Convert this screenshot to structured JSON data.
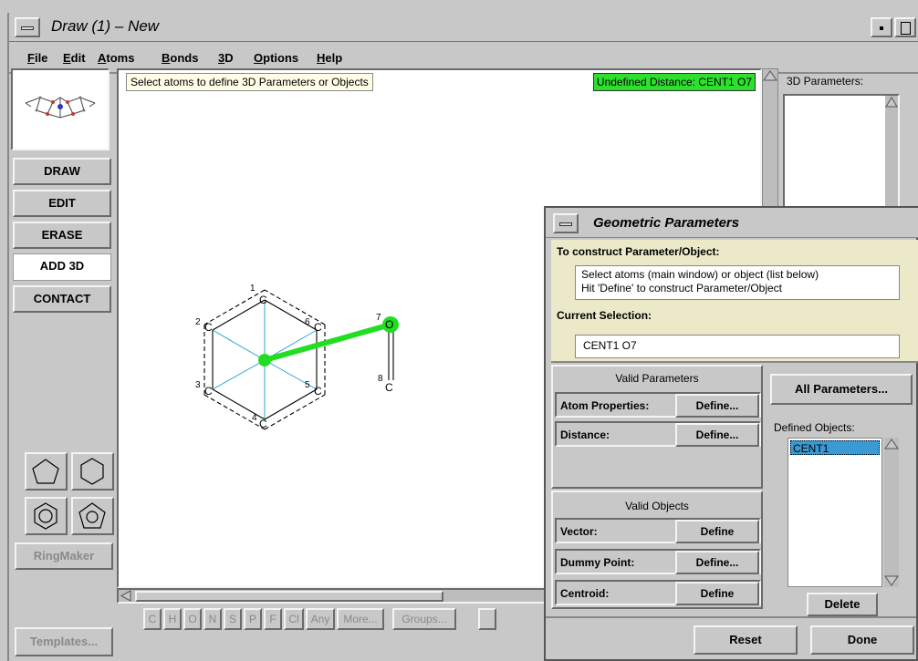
{
  "window": {
    "title": "Draw (1) – New"
  },
  "menubar": {
    "items": [
      {
        "first": "F",
        "rest": "ile"
      },
      {
        "first": "E",
        "rest": "dit"
      },
      {
        "first": "A",
        "rest": "toms"
      },
      {
        "first": "B",
        "rest": "onds"
      },
      {
        "first": "3",
        "rest": "D"
      },
      {
        "first": "O",
        "rest": "ptions"
      },
      {
        "first": "H",
        "rest": "elp"
      }
    ]
  },
  "sidebar": {
    "modes": [
      "DRAW",
      "EDIT",
      "ERASE",
      "ADD 3D",
      "CONTACT"
    ],
    "active_mode": "ADD 3D",
    "ring_shapes": [
      "pentagon-icon",
      "hexagon-icon",
      "benzene-ring-icon",
      "cyclopentadienyl-ring-icon"
    ],
    "ringmaker_label": "RingMaker",
    "templates_label": "Templates..."
  },
  "canvas": {
    "hint": "Select atoms to define 3D Parameters or Objects",
    "status": "Undefined Distance: CENT1 O7",
    "atoms": [
      {
        "num": "1",
        "sym": "C"
      },
      {
        "num": "2",
        "sym": "C"
      },
      {
        "num": "3",
        "sym": "C"
      },
      {
        "num": "4",
        "sym": "C"
      },
      {
        "num": "5",
        "sym": "C"
      },
      {
        "num": "6",
        "sym": "C"
      },
      {
        "num": "7",
        "sym": "O"
      },
      {
        "num": "8",
        "sym": "C"
      }
    ],
    "colors": {
      "selection": "#22dd22",
      "centroid_lines": "#2aa6d8",
      "status_bg": "#2ee02e"
    }
  },
  "element_toolbar": {
    "elements": [
      "C",
      "H",
      "O",
      "N",
      "S",
      "P",
      "F",
      "Cl"
    ],
    "any_label": "Any",
    "more_label": "More...",
    "groups_label": "Groups..."
  },
  "right_panel": {
    "params_label": "3D Parameters:"
  },
  "geo_dialog": {
    "title": "Geometric Parameters",
    "construct_label": "To construct Parameter/Object:",
    "instruction_line1": "Select atoms (main window) or object (list below)",
    "instruction_line2": "Hit 'Define' to construct Parameter/Object",
    "current_selection_label": "Current Selection:",
    "current_selection": "CENT1 O7",
    "valid_params_title": "Valid Parameters",
    "params": [
      {
        "label": "Atom Properties:",
        "button": "Define..."
      },
      {
        "label": "Distance:",
        "button": "Define..."
      }
    ],
    "valid_objects_title": "Valid Objects",
    "objects": [
      {
        "label": "Vector:",
        "button": "Define"
      },
      {
        "label": "Dummy Point:",
        "button": "Define..."
      },
      {
        "label": "Centroid:",
        "button": "Define"
      }
    ],
    "all_params_label": "All Parameters...",
    "defined_objects_label": "Defined Objects:",
    "defined_objects": [
      "CENT1"
    ],
    "delete_label": "Delete",
    "reset_label": "Reset",
    "done_label": "Done"
  }
}
